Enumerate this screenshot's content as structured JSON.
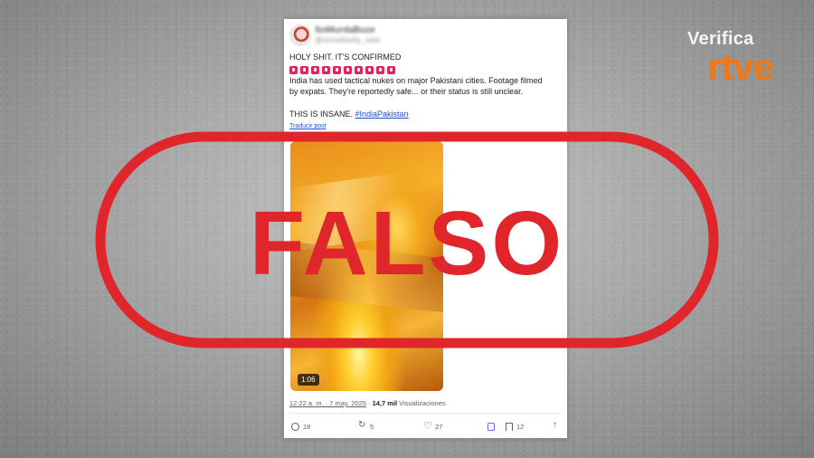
{
  "brand": {
    "top": "Verifica",
    "logo": "rtve"
  },
  "post": {
    "display_name": "SoMurdaBuze",
    "handle": "@somebody_user",
    "line1": "HOLY SHIT. IT'S CONFIRMED",
    "emoji_count": 10,
    "body_line1": "India has used tactical nukes on major Pakistani cities. Footage filmed",
    "body_line2": "by expats. They're reportedly safe... or their status is still unclear.",
    "insane_text": "THIS IS INSANE.",
    "hashtag": "#IndiaPakistan",
    "translate": "Traducir post",
    "video_duration": "1:06",
    "timestamp": "12:22 a. m. · 7 may. 2025",
    "views_count": "14,7 mil",
    "views_label": "Visualizaciones",
    "replies": "18",
    "reposts": "5",
    "likes": "27",
    "bookmarks": "12"
  },
  "stamp": {
    "text": "FALSO",
    "color": "#e0262a"
  }
}
